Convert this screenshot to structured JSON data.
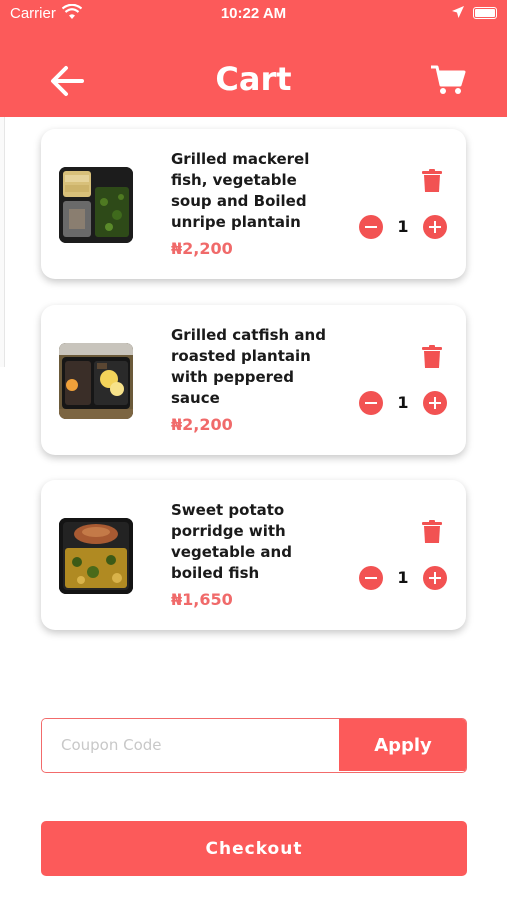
{
  "status_bar": {
    "carrier": "Carrier",
    "time": "10:22 AM"
  },
  "header": {
    "title": "Cart",
    "back_icon": "arrow-left-icon",
    "cart_icon": "shopping-cart-icon",
    "color": "#fc5a5a"
  },
  "cart": {
    "items": [
      {
        "name": "Grilled mackerel fish, vegetable soup and Boiled unripe plantain",
        "price": "₦2,200",
        "quantity": "1"
      },
      {
        "name": "Grilled catfish and roasted plantain with peppered sauce",
        "price": "₦2,200",
        "quantity": "1"
      },
      {
        "name": "Sweet potato porridge with vegetable and boiled fish",
        "price": "₦1,650",
        "quantity": "1"
      }
    ]
  },
  "coupon": {
    "placeholder": "Coupon Code",
    "value": "",
    "apply_label": "Apply"
  },
  "checkout": {
    "label": "Checkout"
  },
  "colors": {
    "accent": "#fc5a5a",
    "price": "#f06a6a"
  }
}
